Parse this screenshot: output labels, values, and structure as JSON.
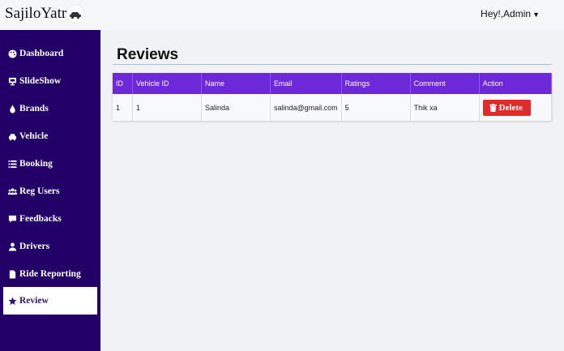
{
  "header": {
    "brand": "SajiloYatra",
    "user_menu": "Hey!,Admin",
    "brand_icon": "car-icon"
  },
  "sidebar": {
    "items": [
      {
        "label": "Dashboard",
        "icon": "palette-icon"
      },
      {
        "label": "SlideShow",
        "icon": "tv-icon"
      },
      {
        "label": "Brands",
        "icon": "tint-icon"
      },
      {
        "label": "Vehicle",
        "icon": "car-icon"
      },
      {
        "label": "Booking",
        "icon": "list-icon"
      },
      {
        "label": "Reg Users",
        "icon": "users-icon"
      },
      {
        "label": "Feedbacks",
        "icon": "comment-icon"
      },
      {
        "label": "Drivers",
        "icon": "user-icon"
      },
      {
        "label": "Ride Reporting",
        "icon": "file-icon"
      },
      {
        "label": "Review",
        "icon": "star-icon",
        "active": true
      }
    ]
  },
  "main": {
    "title": "Reviews",
    "table": {
      "headers": [
        "ID",
        "Vehicle ID",
        "Name",
        "Email",
        "Ratings",
        "Comment",
        "Action"
      ],
      "rows": [
        {
          "id": "1",
          "vehicle_id": "1",
          "name": "Salinda",
          "email": "salinda@gmail.com",
          "ratings": "5",
          "comment": "Thik xa",
          "action": "Delete"
        }
      ]
    }
  },
  "colors": {
    "sidebar": "#230068",
    "table_header": "#6d28d9",
    "delete": "#e22b2b"
  }
}
